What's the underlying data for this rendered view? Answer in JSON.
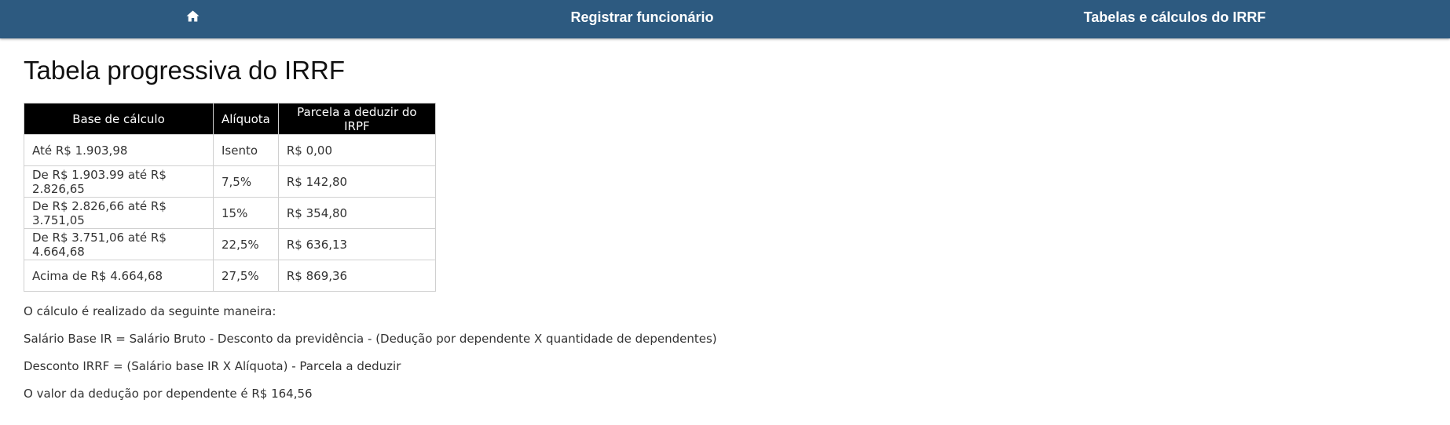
{
  "nav": {
    "home_icon": "home-icon",
    "register_label": "Registrar funcionário",
    "tables_label": "Tabelas e cálculos do IRRF"
  },
  "page": {
    "title": "Tabela progressiva do IRRF"
  },
  "table": {
    "headers": [
      "Base de cálculo",
      "Alíquota",
      "Parcela a deduzir do IRPF"
    ],
    "rows": [
      [
        "Até R$ 1.903,98",
        "Isento",
        "R$ 0,00"
      ],
      [
        "De R$ 1.903.99 até R$ 2.826,65",
        "7,5%",
        "R$ 142,80"
      ],
      [
        "De R$ 2.826,66 até R$ 3.751,05",
        "15%",
        "R$ 354,80"
      ],
      [
        "De R$ 3.751,06 até R$ 4.664,68",
        "22,5%",
        "R$ 636,13"
      ],
      [
        "Acima de R$ 4.664,68",
        "27,5%",
        "R$ 869,36"
      ]
    ]
  },
  "notes": [
    "O cálculo é realizado da seguinte maneira:",
    "Salário Base IR = Salário Bruto - Desconto da previdência - (Dedução por dependente X quantidade de dependentes)",
    "Desconto IRRF = (Salário base IR X Alíquota) - Parcela a deduzir",
    "O valor da dedução por dependente é R$ 164,56"
  ],
  "colors": {
    "navbar": "#2d5a80",
    "table_header": "#000000"
  }
}
